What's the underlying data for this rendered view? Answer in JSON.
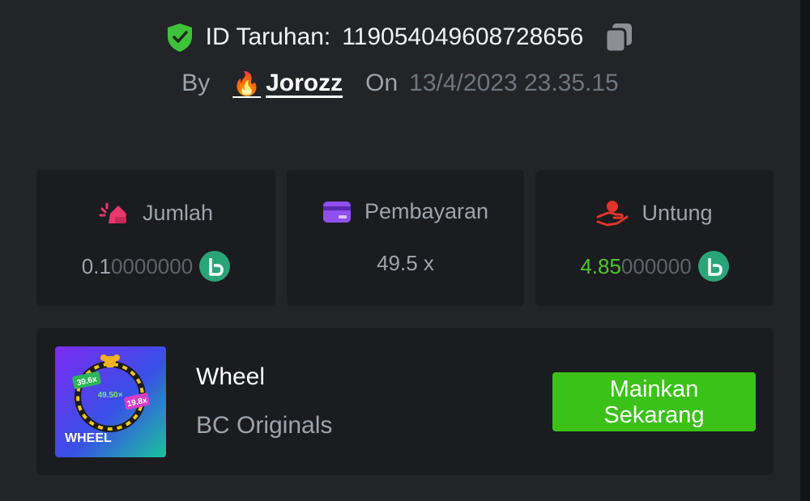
{
  "bet": {
    "id_label": "ID Taruhan:",
    "id_value": "1190540496087 28656",
    "by_label": "By",
    "user_name": "Jorozz",
    "user_emoji": "🔥",
    "on_label": "On",
    "date": "13/4/2023 23.35.15"
  },
  "stats": {
    "amount": {
      "label": "Jumlah",
      "value_bright": "0.1",
      "value_dim": "0000000",
      "icon": "bet-hand-icon"
    },
    "payout": {
      "label": "Pembayaran",
      "value": "49.5 x",
      "icon": "card-icon"
    },
    "profit": {
      "label": "Untung",
      "value_bright": "4.85",
      "value_dim": "000000",
      "icon": "profit-hand-icon"
    }
  },
  "game": {
    "name": "Wheel",
    "provider": "BC Originals",
    "thumb_title": "WHEEL",
    "thumb_center_multiplier": "49.50×",
    "thumb_left_multiplier": "39.6x",
    "thumb_right_multiplier": "19.8x",
    "play_button_label": "Mainkan Sekarang"
  },
  "colors": {
    "background": "#232427",
    "card": "#1b1c1f",
    "accent_green": "#3bc117",
    "profit_green": "#4ec52a",
    "coin": "#2aa57a",
    "shield": "#3ec23b"
  }
}
